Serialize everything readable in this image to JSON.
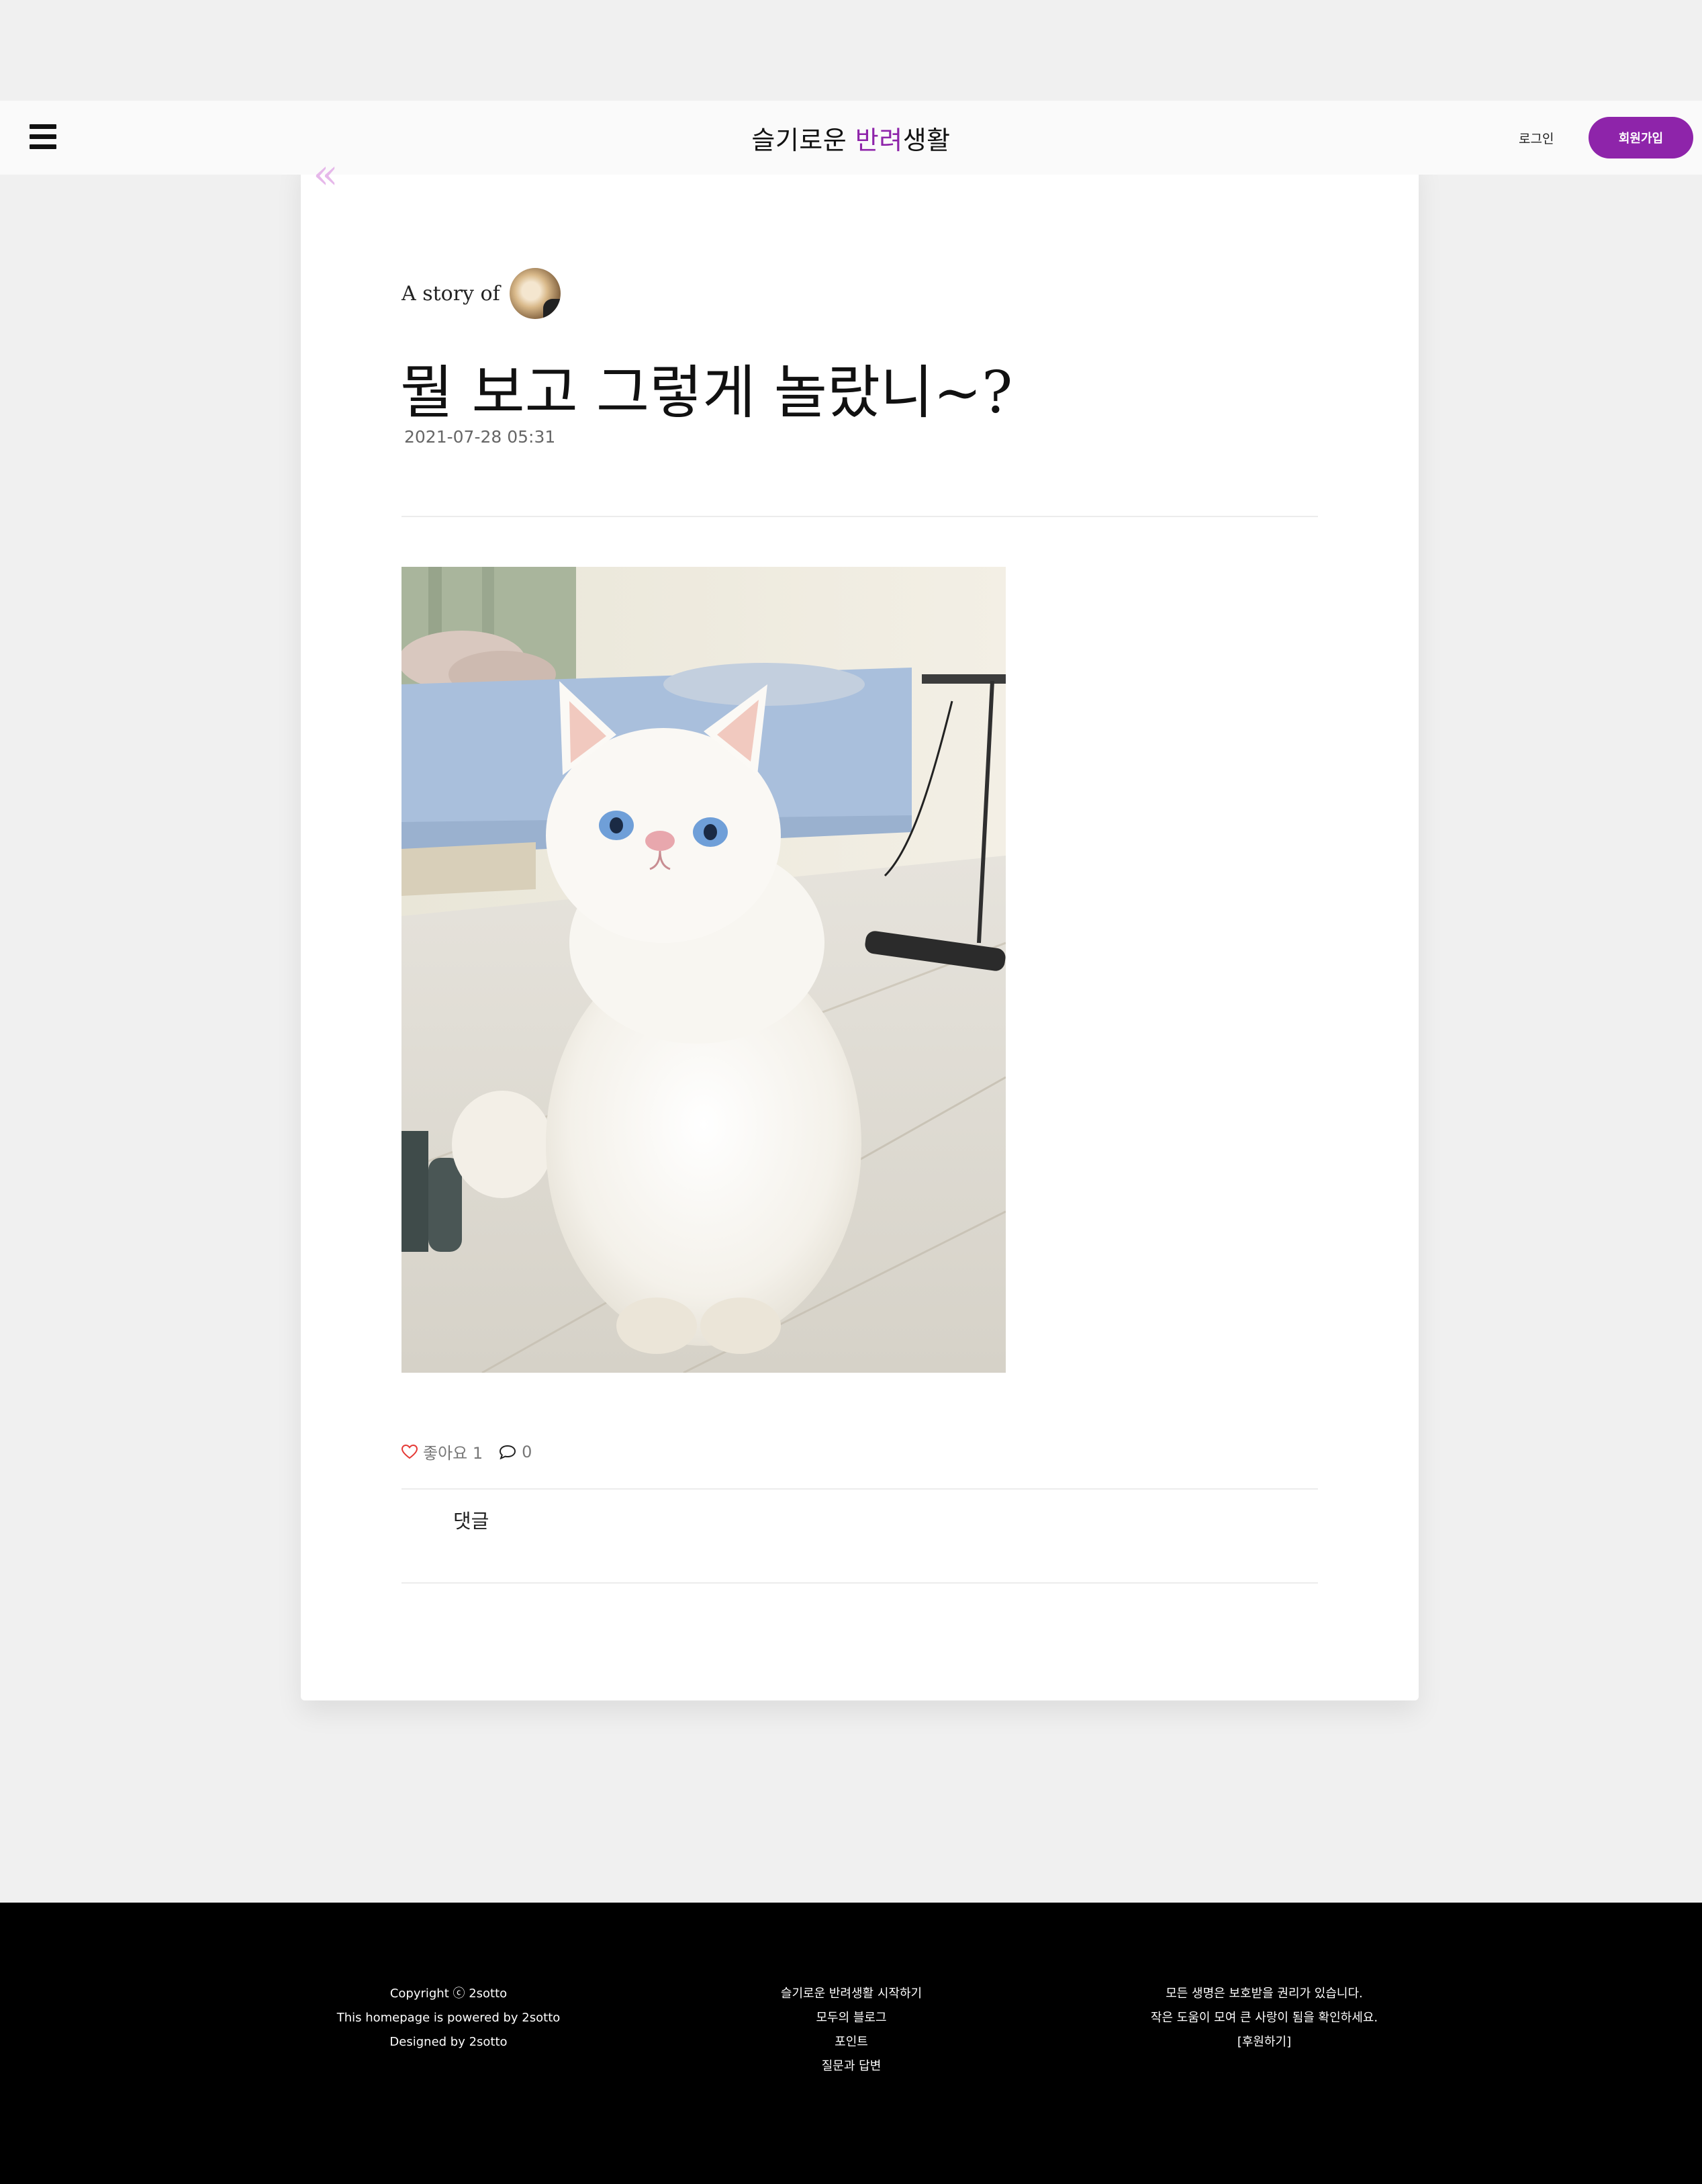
{
  "header": {
    "title_part1": "슬기로운 ",
    "title_accent": "반려",
    "title_part2": "생활",
    "login_label": "로그인",
    "signup_label": "회원가입",
    "accent_color": "#8e24aa",
    "menu_icon": "hamburger-menu-icon"
  },
  "post": {
    "back_label": "«",
    "story_of_label": "A story of",
    "title": "뭘 보고 그렇게 놀랐니~?",
    "date": "2021-07-28 05:31",
    "likes_label": "좋아요 1",
    "comment_count": "0",
    "comments_heading": "댓글",
    "like_icon": "heart-icon",
    "comment_icon": "speech-bubble-icon"
  },
  "footer": {
    "col1": [
      "Copyright ⓒ 2sotto",
      "This homepage is powered by 2sotto",
      "Designed by 2sotto"
    ],
    "col2": [
      "슬기로운 반려생활 시작하기",
      "모두의 블로그",
      "포인트",
      "질문과 답변"
    ],
    "col3": [
      "모든 생명은 보호받을 권리가 있습니다.",
      "작은 도움이 모여 큰 사랑이 됨을 확인하세요.",
      "[후원하기]"
    ]
  }
}
